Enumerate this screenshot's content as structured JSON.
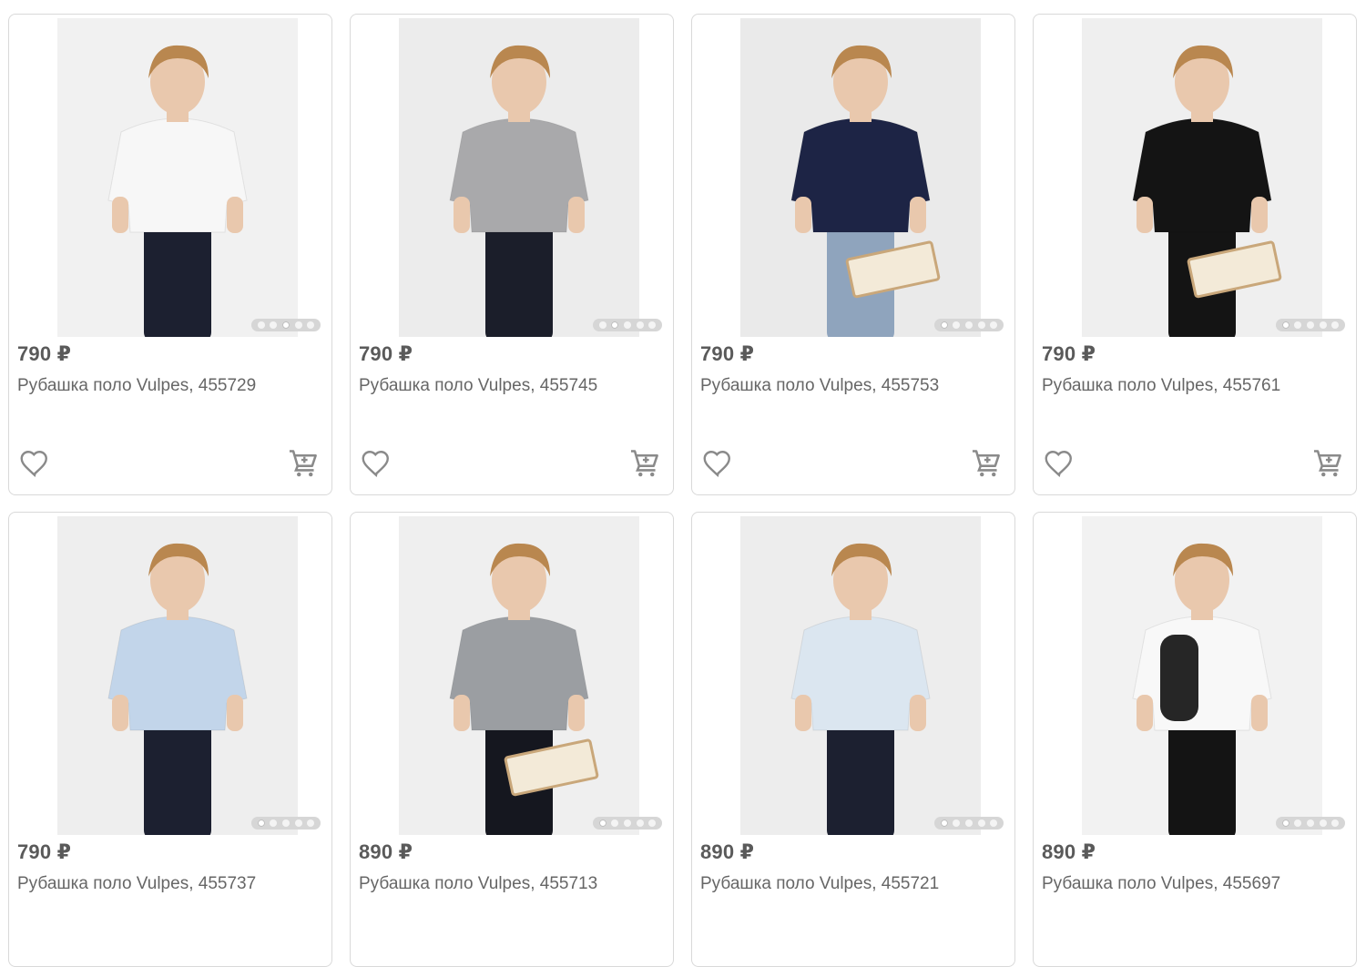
{
  "currency": "₽",
  "products": [
    {
      "price": "790 ₽",
      "title": "Рубашка поло Vulpes, 455729",
      "shirt_color": "#f7f7f7",
      "pants_color": "#1c2030",
      "bg": "#f1f1f1",
      "active_dot": 2,
      "accessory": "none"
    },
    {
      "price": "790 ₽",
      "title": "Рубашка поло Vulpes, 455745",
      "shirt_color": "#a9a9ab",
      "pants_color": "#1b1e2a",
      "bg": "#ececec",
      "active_dot": 1,
      "accessory": "none"
    },
    {
      "price": "790 ₽",
      "title": "Рубашка поло Vulpes, 455753",
      "shirt_color": "#1d2445",
      "pants_color": "#8fa4bd",
      "bg": "#eaeaea",
      "active_dot": 0,
      "accessory": "book"
    },
    {
      "price": "790 ₽",
      "title": "Рубашка поло Vulpes, 455761",
      "shirt_color": "#141414",
      "pants_color": "#141414",
      "bg": "#efefef",
      "active_dot": 0,
      "accessory": "book"
    },
    {
      "price": "790 ₽",
      "title": "Рубашка поло Vulpes, 455737",
      "shirt_color": "#c2d5ea",
      "pants_color": "#1c2030",
      "bg": "#eeeeee",
      "active_dot": 0,
      "accessory": "none"
    },
    {
      "price": "890 ₽",
      "title": "Рубашка поло Vulpes, 455713",
      "shirt_color": "#9b9ea2",
      "pants_color": "#15171f",
      "bg": "#efefef",
      "active_dot": 0,
      "accessory": "book"
    },
    {
      "price": "890 ₽",
      "title": "Рубашка поло Vulpes, 455721",
      "shirt_color": "#dbe6f0",
      "pants_color": "#1c2030",
      "bg": "#ededed",
      "active_dot": 0,
      "accessory": "none"
    },
    {
      "price": "890 ₽",
      "title": "Рубашка поло Vulpes, 455697",
      "shirt_color": "#f8f8f8",
      "pants_color": "#141414",
      "bg": "#f2f2f2",
      "active_dot": 0,
      "accessory": "backpack"
    }
  ],
  "icons": {
    "favorite": "heart-icon",
    "cart": "cart-icon"
  }
}
